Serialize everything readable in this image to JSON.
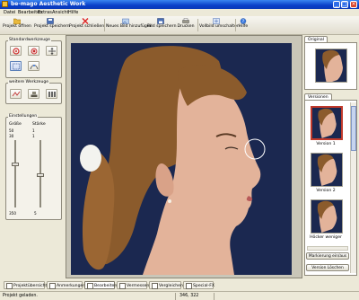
{
  "window": {
    "title": "be-mago Aesthetic Work"
  },
  "menu": [
    "Datei",
    "Bearbeiten",
    "Extras",
    "Ansicht",
    "Hilfe"
  ],
  "toolbar": [
    {
      "label": "Projekt öffnen",
      "icon": "folder-open-icon"
    },
    {
      "label": "Projekt speichern",
      "icon": "save-icon"
    },
    {
      "label": "Projekt schließen",
      "icon": "close-project-icon"
    },
    {
      "label": "Neues Bild hinzufügen",
      "icon": "add-image-icon"
    },
    {
      "label": "Bild speichern",
      "icon": "save-image-icon"
    },
    {
      "label": "Drucken",
      "icon": "printer-icon"
    },
    {
      "label": "Vollbild umschalten",
      "icon": "fullscreen-icon"
    },
    {
      "label": "Hilfe",
      "icon": "help-icon"
    }
  ],
  "left_panel": {
    "standard_tools_title": "Standardwerkzeuge",
    "more_tools_title": "weitere Werkzeuge",
    "settings_title": "Einstellungen",
    "size_label": "Größe",
    "strength_label": "Stärke",
    "size_max": "50",
    "size_min": "0",
    "size_current": "30",
    "size_bottom": "350",
    "strength_max": "1",
    "strength_min": "1",
    "strength_current": "1",
    "strength_bottom": "5"
  },
  "right_panel": {
    "original_tab": "Original",
    "versions_tab": "Versionen",
    "versions": [
      {
        "label": "Version 1",
        "selected": true
      },
      {
        "label": "Version 2",
        "selected": false
      },
      {
        "label": "Höcker weniger",
        "selected": false
      }
    ],
    "mark_button": "Markierung ein/aus",
    "delete_button": "Version Löschen"
  },
  "bottom_tabs": [
    {
      "label": "Projektübersicht",
      "selected": false
    },
    {
      "label": "Anmerkungen",
      "selected": false
    },
    {
      "label": "Bearbeiten",
      "selected": true
    },
    {
      "label": "Vermessen",
      "selected": false
    },
    {
      "label": "Vergleichen",
      "selected": false
    },
    {
      "label": "Special-FX",
      "selected": false
    }
  ],
  "status": {
    "left": "Projekt geladen.",
    "coords": "346, 322"
  },
  "colors": {
    "titlebar": "#0a3fc9",
    "background": "#ece9d8",
    "photo_bg": "#1b2850",
    "selected_border": "#c0392b"
  }
}
